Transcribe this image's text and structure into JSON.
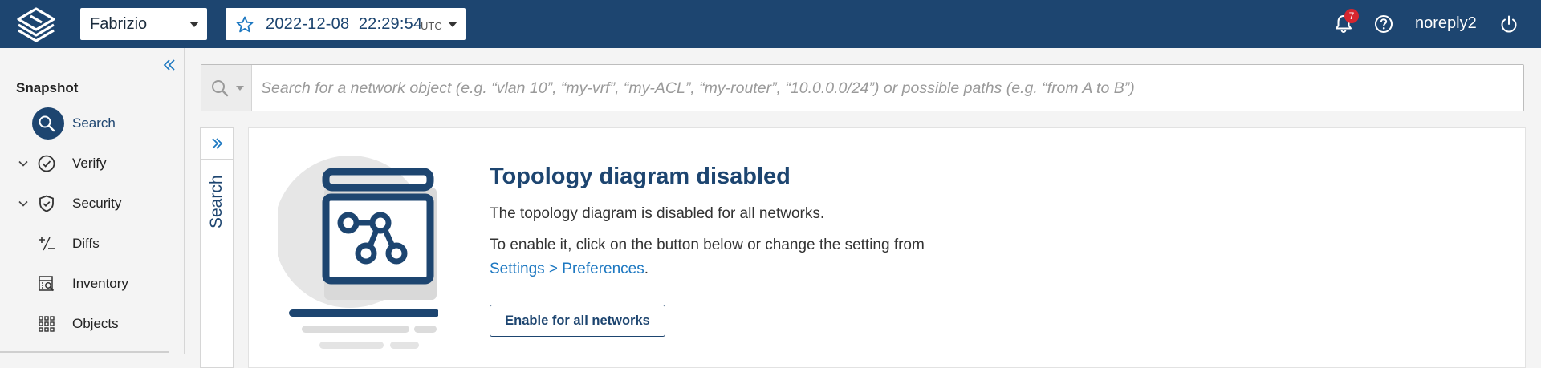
{
  "topbar": {
    "workspace": "Fabrizio",
    "snapshot_datetime": "2022-12-08  22:29:54",
    "timezone": "UTC",
    "notification_count": "7",
    "username": "noreply2"
  },
  "sidebar": {
    "title": "Snapshot",
    "items": [
      {
        "label": "Search",
        "icon": "search-icon",
        "active": true
      },
      {
        "label": "Verify",
        "icon": "check-circle-icon",
        "expandable": true
      },
      {
        "label": "Security",
        "icon": "shield-icon",
        "expandable": true
      },
      {
        "label": "Diffs",
        "icon": "plus-minus-icon"
      },
      {
        "label": "Inventory",
        "icon": "inventory-icon"
      },
      {
        "label": "Objects",
        "icon": "grid-icon"
      }
    ]
  },
  "search": {
    "placeholder": "Search for a network object (e.g. “vlan 10”, “my-vrf”, “my-ACL”, “my-router”, “10.0.0.0/24”) or possible paths (e.g. “from A to B”)"
  },
  "side_panel": {
    "label": "Search"
  },
  "main": {
    "heading": "Topology diagram disabled",
    "line1": "The topology diagram is disabled for all networks.",
    "line2": "To enable it, click on the button below or change the setting from",
    "settings_link": "Settings > Preferences",
    "link_suffix": ".",
    "enable_button": "Enable for all networks"
  },
  "colors": {
    "brand": "#1d4570",
    "link": "#1d78c1",
    "badge": "#d6262f",
    "background": "#f4f4f4"
  }
}
